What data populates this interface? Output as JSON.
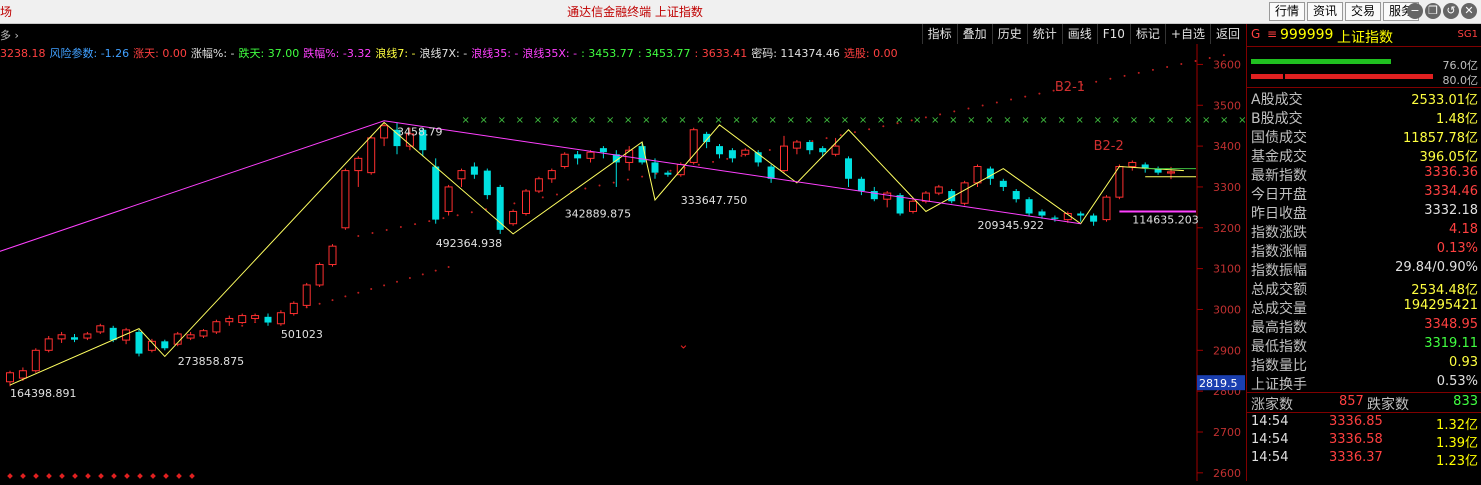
{
  "titlebar": {
    "left_fragment": "场",
    "title": "通达信金融终端 上证指数",
    "buttons": [
      "行情",
      "资讯",
      "交易",
      "服务"
    ],
    "win_glyphs": [
      "−",
      "❐",
      "↺",
      "✕"
    ]
  },
  "toolbar": {
    "left_fragment": "多 ›",
    "buttons": [
      "指标",
      "叠加",
      "历史",
      "统计",
      "画线",
      "F10",
      "标记",
      "+自选",
      "返回"
    ],
    "small_icons": [
      "◇",
      "▣"
    ]
  },
  "indicator_row": [
    {
      "text": "3238.18",
      "color": "#ff4040"
    },
    {
      "text": "风险参数: -1.26",
      "color": "#40a0ff"
    },
    {
      "text": "涨天: 0.00",
      "color": "#ff4040"
    },
    {
      "text": "涨幅%: -",
      "color": "#e0e0e0"
    },
    {
      "text": "跌天: 37.00",
      "color": "#40ff40"
    },
    {
      "text": "跌幅%: -3.32",
      "color": "#ff40ff"
    },
    {
      "text": "浪线7: -",
      "color": "#ffff40"
    },
    {
      "text": "浪线7X: -",
      "color": "#e0e0e0"
    },
    {
      "text": "浪线35: -",
      "color": "#ff40ff"
    },
    {
      "text": "浪线35X: -",
      "color": "#ff40ff"
    },
    {
      "text": ": 3453.77",
      "color": "#40ff40"
    },
    {
      "text": ": 3453.77",
      "color": "#40ff40"
    },
    {
      "text": ": 3633.41",
      "color": "#ff4040"
    },
    {
      "text": "密码: 114374.46",
      "color": "#e0e0e0"
    },
    {
      "text": "选股: 0.00",
      "color": "#ff4040"
    }
  ],
  "chart_data": {
    "type": "candlestick",
    "ylim": [
      2580,
      3650
    ],
    "y_ticks": [
      2600,
      2700,
      2800,
      2900,
      3000,
      3100,
      3200,
      3300,
      3400,
      3500,
      3600
    ],
    "current_price_label": "2819.5",
    "candles": [
      [
        2823,
        2845,
        2812,
        2850
      ],
      [
        2832,
        2850,
        2825,
        2858
      ],
      [
        2850,
        2900,
        2845,
        2905
      ],
      [
        2900,
        2928,
        2895,
        2935
      ],
      [
        2928,
        2938,
        2918,
        2945
      ],
      [
        2932,
        2926,
        2920,
        2940
      ],
      [
        2930,
        2940,
        2925,
        2945
      ],
      [
        2945,
        2960,
        2940,
        2965
      ],
      [
        2955,
        2925,
        2920,
        2960
      ],
      [
        2925,
        2950,
        2915,
        2955
      ],
      [
        2945,
        2892,
        2885,
        2950
      ],
      [
        2900,
        2922,
        2895,
        2928
      ],
      [
        2922,
        2905,
        2900,
        2926
      ],
      [
        2915,
        2940,
        2910,
        2945
      ],
      [
        2930,
        2938,
        2925,
        2945
      ],
      [
        2935,
        2948,
        2930,
        2952
      ],
      [
        2945,
        2970,
        2940,
        2975
      ],
      [
        2970,
        2978,
        2960,
        2985
      ],
      [
        2968,
        2985,
        2965,
        2990
      ],
      [
        2978,
        2985,
        2972,
        2990
      ],
      [
        2982,
        2968,
        2960,
        2990
      ],
      [
        2965,
        2992,
        2960,
        2998
      ],
      [
        2990,
        3015,
        2985,
        3020
      ],
      [
        3010,
        3060,
        3005,
        3065
      ],
      [
        3060,
        3110,
        3055,
        3115
      ],
      [
        3110,
        3155,
        3105,
        3160
      ],
      [
        3200,
        3340,
        3195,
        3345
      ],
      [
        3340,
        3370,
        3300,
        3375
      ],
      [
        3335,
        3420,
        3330,
        3425
      ],
      [
        3420,
        3450,
        3400,
        3455
      ],
      [
        3440,
        3400,
        3380,
        3458
      ],
      [
        3400,
        3430,
        3390,
        3445
      ],
      [
        3440,
        3390,
        3375,
        3445
      ],
      [
        3350,
        3220,
        3210,
        3370
      ],
      [
        3240,
        3300,
        3230,
        3305
      ],
      [
        3320,
        3340,
        3300,
        3345
      ],
      [
        3350,
        3330,
        3320,
        3360
      ],
      [
        3340,
        3280,
        3270,
        3345
      ],
      [
        3300,
        3195,
        3185,
        3305
      ],
      [
        3210,
        3240,
        3205,
        3245
      ],
      [
        3235,
        3290,
        3230,
        3295
      ],
      [
        3290,
        3320,
        3285,
        3325
      ],
      [
        3320,
        3340,
        3310,
        3345
      ],
      [
        3350,
        3380,
        3345,
        3385
      ],
      [
        3380,
        3370,
        3355,
        3388
      ],
      [
        3370,
        3385,
        3360,
        3390
      ],
      [
        3395,
        3385,
        3370,
        3400
      ],
      [
        3380,
        3360,
        3300,
        3390
      ],
      [
        3360,
        3390,
        3340,
        3400
      ],
      [
        3400,
        3360,
        3355,
        3410
      ],
      [
        3360,
        3335,
        3320,
        3370
      ],
      [
        3335,
        3330,
        3325,
        3340
      ],
      [
        3330,
        3355,
        3325,
        3360
      ],
      [
        3360,
        3440,
        3355,
        3445
      ],
      [
        3430,
        3410,
        3395,
        3435
      ],
      [
        3400,
        3380,
        3370,
        3405
      ],
      [
        3390,
        3370,
        3360,
        3395
      ],
      [
        3380,
        3390,
        3375,
        3395
      ],
      [
        3385,
        3360,
        3350,
        3390
      ],
      [
        3350,
        3320,
        3310,
        3355
      ],
      [
        3340,
        3400,
        3335,
        3425
      ],
      [
        3395,
        3410,
        3380,
        3415
      ],
      [
        3410,
        3390,
        3380,
        3415
      ],
      [
        3395,
        3385,
        3375,
        3400
      ],
      [
        3380,
        3400,
        3375,
        3420
      ],
      [
        3370,
        3320,
        3300,
        3375
      ],
      [
        3320,
        3290,
        3280,
        3325
      ],
      [
        3290,
        3270,
        3265,
        3300
      ],
      [
        3270,
        3285,
        3250,
        3290
      ],
      [
        3280,
        3235,
        3230,
        3285
      ],
      [
        3240,
        3265,
        3235,
        3270
      ],
      [
        3265,
        3285,
        3260,
        3290
      ],
      [
        3285,
        3300,
        3280,
        3305
      ],
      [
        3290,
        3265,
        3260,
        3295
      ],
      [
        3260,
        3310,
        3255,
        3315
      ],
      [
        3310,
        3350,
        3300,
        3355
      ],
      [
        3345,
        3320,
        3305,
        3350
      ],
      [
        3315,
        3300,
        3290,
        3320
      ],
      [
        3290,
        3270,
        3262,
        3295
      ],
      [
        3270,
        3235,
        3228,
        3275
      ],
      [
        3240,
        3230,
        3222,
        3245
      ],
      [
        3225,
        3222,
        3215,
        3230
      ],
      [
        3220,
        3235,
        3212,
        3240
      ],
      [
        3235,
        3230,
        3215,
        3240
      ],
      [
        3230,
        3215,
        3205,
        3235
      ],
      [
        3220,
        3275,
        3215,
        3280
      ],
      [
        3275,
        3350,
        3270,
        3355
      ],
      [
        3350,
        3360,
        3340,
        3365
      ],
      [
        3355,
        3345,
        3335,
        3360
      ],
      [
        3345,
        3335,
        3330,
        3350
      ],
      [
        3334,
        3337,
        3319,
        3349
      ]
    ],
    "series": [
      {
        "name": "浪线7",
        "points": [
          [
            0,
            2815
          ],
          [
            10,
            2953
          ],
          [
            12,
            2885
          ],
          [
            29,
            3458
          ],
          [
            39,
            3185
          ],
          [
            49,
            3410
          ],
          [
            50,
            3268
          ],
          [
            55,
            3452
          ],
          [
            61,
            3310
          ],
          [
            65,
            3440
          ],
          [
            71,
            3240
          ],
          [
            77,
            3345
          ],
          [
            83,
            3210
          ],
          [
            86,
            3350
          ],
          [
            91,
            3340
          ]
        ]
      },
      {
        "name": "浪线35",
        "points": [
          [
            -1,
            3140
          ],
          [
            29,
            3462
          ],
          [
            83,
            3210
          ]
        ]
      }
    ],
    "annotations": [
      {
        "text": "164398.891",
        "x": 0,
        "y": 2815
      },
      {
        "text": "273858.875",
        "x": 13,
        "y": 2893
      },
      {
        "text": "501023",
        "x": 21,
        "y": 2960
      },
      {
        "text": "3458.79",
        "x": 30,
        "y": 3455
      },
      {
        "text": "492364.938",
        "x": 33,
        "y": 3182
      },
      {
        "text": "342889.875",
        "x": 43,
        "y": 3255
      },
      {
        "text": "333647.750",
        "x": 52,
        "y": 3288
      },
      {
        "text": "209345.922",
        "x": 75,
        "y": 3227
      },
      {
        "text": "114635.203",
        "x": 87,
        "y": 3240
      },
      {
        "text": "B2-1",
        "x": 81,
        "y": 3535
      },
      {
        "text": "B2-2",
        "x": 84,
        "y": 3390
      }
    ],
    "x_marks": {
      "y": 3464,
      "from": 35,
      "to": 97
    },
    "support_line": {
      "y": 3240,
      "from": 86,
      "to": 97
    },
    "green_line": {
      "y": 3345,
      "from": 88,
      "to": 97
    },
    "yellow_short": {
      "y": 3325,
      "from": 88,
      "to": 97
    }
  },
  "sidepanel": {
    "g": "G",
    "eq": "≡",
    "code": "999999",
    "name": "上证指数",
    "sg": "SG1",
    "bar_values": [
      "76.0亿",
      "80.0亿"
    ],
    "kv": [
      {
        "k": "A股成交",
        "v": "2533.01亿",
        "c": "#ffff40"
      },
      {
        "k": "B股成交",
        "v": "1.48亿",
        "c": "#ffff40"
      },
      {
        "k": "国债成交",
        "v": "11857.78亿",
        "c": "#ffff40"
      },
      {
        "k": "基金成交",
        "v": "396.05亿",
        "c": "#ffff40"
      },
      {
        "k": "最新指数",
        "v": "3336.36",
        "c": "#ff4040"
      },
      {
        "k": "今日开盘",
        "v": "3334.46",
        "c": "#ff4040"
      },
      {
        "k": "昨日收盘",
        "v": "3332.18",
        "c": "#e0e0e0"
      },
      {
        "k": "指数涨跌",
        "v": "4.18",
        "c": "#ff4040"
      },
      {
        "k": "指数涨幅",
        "v": "0.13%",
        "c": "#ff4040"
      },
      {
        "k": "指数振幅",
        "v": "29.84/0.90%",
        "c": "#e0e0e0"
      },
      {
        "k": "总成交额",
        "v": "2534.48亿",
        "c": "#ffff40"
      },
      {
        "k": "总成交量",
        "v": "194295421",
        "c": "#ffff40"
      },
      {
        "k": "最高指数",
        "v": "3348.95",
        "c": "#ff4040"
      },
      {
        "k": "最低指数",
        "v": "3319.11",
        "c": "#40ff40"
      },
      {
        "k": "指数量比",
        "v": "0.93",
        "c": "#ffff40"
      },
      {
        "k": "上证换手",
        "v": "0.53%",
        "c": "#e0e0e0"
      }
    ],
    "up_label": "涨家数",
    "up_count": "857",
    "down_label": "跌家数",
    "down_count": "833",
    "ticks": [
      {
        "t": "14:54",
        "p": "3336.85",
        "v": "1.32亿"
      },
      {
        "t": "14:54",
        "p": "3336.58",
        "v": "1.39亿"
      },
      {
        "t": "14:54",
        "p": "3336.37",
        "v": "1.23亿"
      }
    ]
  }
}
